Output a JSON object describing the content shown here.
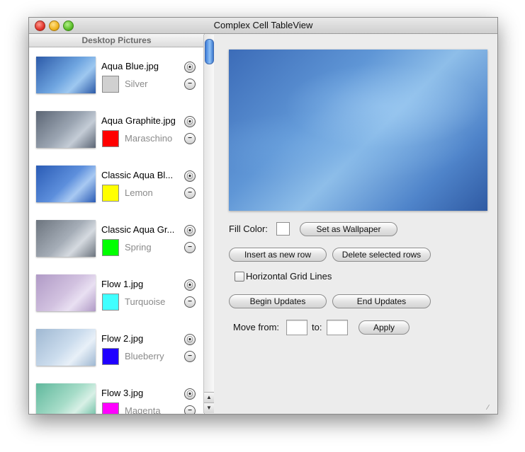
{
  "window": {
    "title": "Complex Cell TableView"
  },
  "table": {
    "header": "Desktop Pictures",
    "rows": [
      {
        "file": "Aqua Blue.jpg",
        "color_name": "Silver",
        "swatch": "#d0d0d0",
        "thumb": [
          "#2c5aa8",
          "#6fa5e0",
          "#9ec8f0"
        ]
      },
      {
        "file": "Aqua Graphite.jpg",
        "color_name": "Maraschino",
        "swatch": "#ff0000",
        "thumb": [
          "#5b6574",
          "#9ca6b3",
          "#c4ccd6"
        ]
      },
      {
        "file": "Classic Aqua Bl...",
        "color_name": "Lemon",
        "swatch": "#ffff00",
        "thumb": [
          "#2a5bb5",
          "#5d8fdc",
          "#a8c9f2"
        ]
      },
      {
        "file": "Classic Aqua Gr...",
        "color_name": "Spring",
        "swatch": "#00ff00",
        "thumb": [
          "#6c747e",
          "#a5adb7",
          "#d5dae0"
        ]
      },
      {
        "file": "Flow 1.jpg",
        "color_name": "Turquoise",
        "swatch": "#40ffff",
        "thumb": [
          "#b09ac6",
          "#d2c2e0",
          "#e9e0f2"
        ]
      },
      {
        "file": "Flow 2.jpg",
        "color_name": "Blueberry",
        "swatch": "#2000ff",
        "thumb": [
          "#9fb8d2",
          "#cbdced",
          "#e8f0f8"
        ]
      },
      {
        "file": "Flow 3.jpg",
        "color_name": "Magenta",
        "swatch": "#ff00ff",
        "thumb": [
          "#5fb89c",
          "#a6dcc8",
          "#d8f0e6"
        ]
      }
    ],
    "info_glyph": "⦿",
    "remove_glyph": "−",
    "scroll_up_glyph": "▲",
    "scroll_down_glyph": "▼"
  },
  "controls": {
    "fill_color_label": "Fill Color:",
    "set_wallpaper": "Set as Wallpaper",
    "insert_row": "Insert as new row",
    "delete_rows": "Delete selected rows",
    "grid_lines_label": "Horizontal Grid Lines",
    "begin_updates": "Begin Updates",
    "end_updates": "End Updates",
    "move_from_label": "Move from:",
    "move_to_label": "to:",
    "apply": "Apply"
  }
}
